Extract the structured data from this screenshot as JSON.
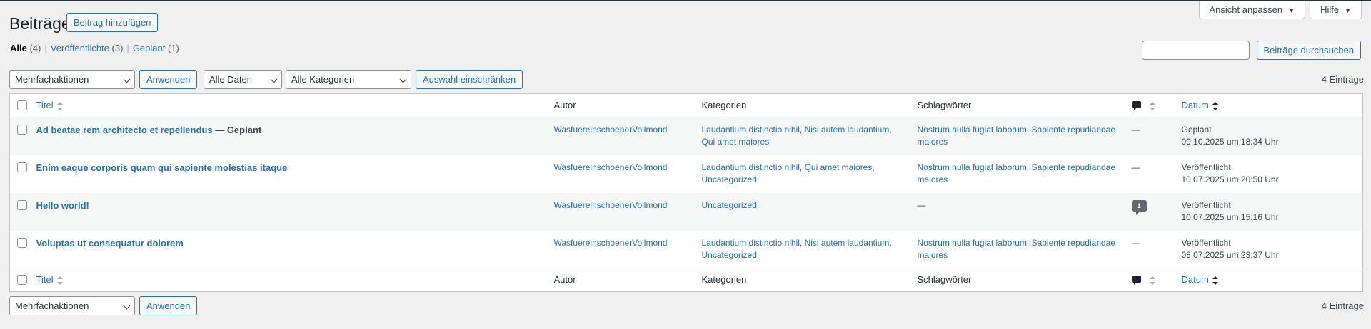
{
  "screen_options": {
    "view_label": "Ansicht anpassen",
    "help_label": "Hilfe"
  },
  "page": {
    "title": "Beiträge",
    "add_new_label": "Beitrag hinzufügen"
  },
  "views": {
    "all_label": "Alle",
    "all_count": "(4)",
    "published_label": "Veröffentlichte",
    "published_count": "(3)",
    "scheduled_label": "Geplant",
    "scheduled_count": "(1)",
    "separator": "|"
  },
  "search": {
    "input_value": "",
    "button_label": "Beiträge durchsuchen"
  },
  "tablenav_top": {
    "bulk_action": "Mehrfachaktionen",
    "apply_label": "Anwenden",
    "date_filter": "Alle Daten",
    "category_filter": "Alle Kategorien",
    "filter_button": "Auswahl einschränken",
    "items_count": "4 Einträge"
  },
  "tablenav_bottom": {
    "bulk_action": "Mehrfachaktionen",
    "apply_label": "Anwenden",
    "items_count": "4 Einträge"
  },
  "columns": {
    "title": "Titel",
    "author": "Autor",
    "categories": "Kategorien",
    "tags": "Schlagwörter",
    "date": "Datum"
  },
  "posts": [
    {
      "title": "Ad beatae rem architecto et repellendus",
      "state": " — Geplant",
      "author": "WasfuereinschoenerVollmond",
      "categories": [
        "Laudantium distinctio nihil",
        "Nisi autem laudantium",
        "Qui amet maiores"
      ],
      "tags": [
        "Nostrum nulla fugiat laborum",
        "Sapiente repudiandae maiores"
      ],
      "comments": "—",
      "date_status": "Geplant",
      "date": "09.10.2025 um 18:34 Uhr"
    },
    {
      "title": "Enim eaque corporis quam qui sapiente molestias itaque",
      "state": "",
      "author": "WasfuereinschoenerVollmond",
      "categories": [
        "Laudantium distinctio nihil",
        "Qui amet maiores",
        "Uncategorized"
      ],
      "tags": [
        "Nostrum nulla fugiat laborum",
        "Sapiente repudiandae maiores"
      ],
      "comments": "—",
      "date_status": "Veröffentlicht",
      "date": "10.07.2025 um 20:50 Uhr"
    },
    {
      "title": "Hello world!",
      "state": "",
      "author": "WasfuereinschoenerVollmond",
      "categories": [
        "Uncategorized"
      ],
      "tags_empty": "—",
      "comments": "1",
      "date_status": "Veröffentlicht",
      "date": "10.07.2025 um 15:16 Uhr"
    },
    {
      "title": "Voluptas ut consequatur dolorem",
      "state": "",
      "author": "WasfuereinschoenerVollmond",
      "categories": [
        "Laudantium distinctio nihil",
        "Nisi autem laudantium",
        "Uncategorized"
      ],
      "tags": [
        "Nostrum nulla fugiat laborum",
        "Sapiente repudiandae maiores"
      ],
      "comments": "—",
      "date_status": "Veröffentlicht",
      "date": "08.07.2025 um 23:37 Uhr"
    }
  ],
  "icons": {
    "comment_column": "comment-bubble-icon",
    "sort": "sort-arrows-icon",
    "dropdown": "chevron-down-icon"
  },
  "colors": {
    "link": "#2271b1",
    "background": "#f0f0f1",
    "text": "#3c434a"
  }
}
